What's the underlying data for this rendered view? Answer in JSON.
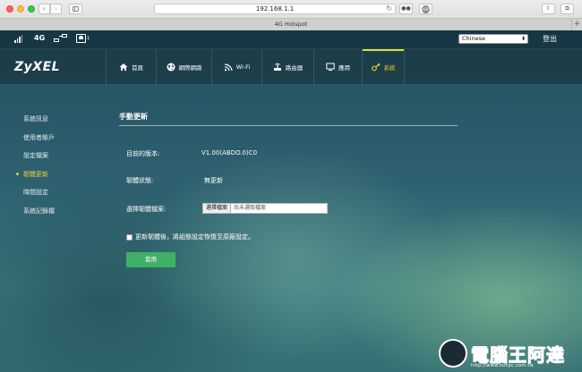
{
  "browser": {
    "url": "192.168.1.1",
    "tab_title": "4G Hotspot",
    "add_tab": "+",
    "reload": "↻"
  },
  "topbar": {
    "lte": "4G",
    "sms_count": "1",
    "language": "Chinese",
    "logout": "登出"
  },
  "header": {
    "logo": "ZyXEL",
    "menu": [
      {
        "label": "首頁",
        "icon": "home-icon"
      },
      {
        "label": "網際網路",
        "icon": "globe-icon"
      },
      {
        "label": "Wi-Fi",
        "icon": "wifi-icon"
      },
      {
        "label": "路由器",
        "icon": "router-icon"
      },
      {
        "label": "應用",
        "icon": "monitor-icon"
      },
      {
        "label": "系統",
        "icon": "key-icon"
      }
    ]
  },
  "sidebar": {
    "items": [
      {
        "label": "系統訊息"
      },
      {
        "label": "使用者帳戶"
      },
      {
        "label": "設定檔案"
      },
      {
        "label": "韌體更新"
      },
      {
        "label": "時間設定"
      },
      {
        "label": "系統記錄檔"
      }
    ]
  },
  "content": {
    "title": "手動更新",
    "current_version_label": "目前的版本:",
    "current_version_value": "V1.00(ABDO.0)C0",
    "firmware_status_label": "韌體狀態:",
    "firmware_status_value": "無更新",
    "select_file_label": "選擇韌體檔案:",
    "choose_file_button": "選擇檔案",
    "no_file_text": "尚未選取檔案",
    "restore_checkbox_label": "更新韌體後，將組態設定恢復至原廠設定。",
    "apply_button": "套用"
  },
  "watermark": {
    "text": "電腦王阿達",
    "url": "http://www.kocpc.com.tw"
  }
}
